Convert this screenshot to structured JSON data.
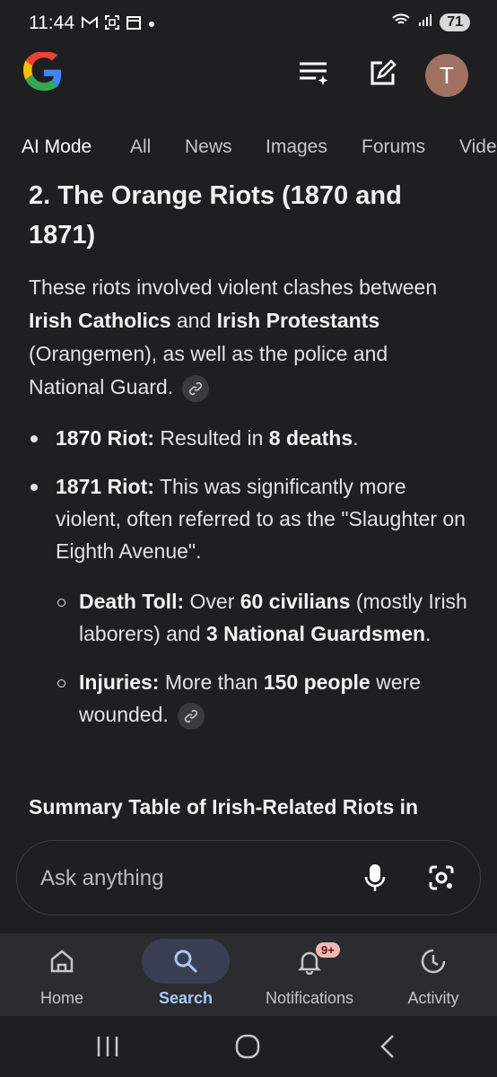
{
  "status": {
    "time": "11:44",
    "battery": "71"
  },
  "header": {
    "avatar_letter": "T"
  },
  "tabs": [
    {
      "label": "AI Mode"
    },
    {
      "label": "All"
    },
    {
      "label": "News"
    },
    {
      "label": "Images"
    },
    {
      "label": "Forums"
    },
    {
      "label": "Vide"
    }
  ],
  "content": {
    "heading": "2. The Orange Riots (1870 and 1871)",
    "para_1": "These riots involved violent clashes between ",
    "para_b1": "Irish Catholics",
    "para_2": " and ",
    "para_b2": "Irish Protestants",
    "para_3": " (Orangemen), as well as the police and National Guard.",
    "b1_label": "1870 Riot:",
    "b1_text": " Resulted in ",
    "b1_bold": "8 deaths",
    "b1_end": ".",
    "b2_label": "1871 Riot:",
    "b2_text": " This was significantly more violent, often referred to as the \"Slaughter on Eighth Avenue\".",
    "s1_label": "Death Toll:",
    "s1_t1": " Over ",
    "s1_b1": "60 civilians",
    "s1_t2": " (mostly Irish laborers) and ",
    "s1_b2": "3 National Guardsmen",
    "s1_t3": ".",
    "s2_label": "Injuries:",
    "s2_t1": " More than ",
    "s2_b1": "150 people",
    "s2_t2": " were wounded.",
    "summary": "Summary Table of Irish-Related Riots in"
  },
  "ask": {
    "placeholder": "Ask anything"
  },
  "bottom_nav": [
    {
      "label": "Home"
    },
    {
      "label": "Search"
    },
    {
      "label": "Notifications",
      "badge": "9+"
    },
    {
      "label": "Activity"
    }
  ],
  "colors": {
    "background": "#1f1f21",
    "accent": "#a8c7fa",
    "badge": "#f2b8b5",
    "avatar": "#a07062"
  }
}
